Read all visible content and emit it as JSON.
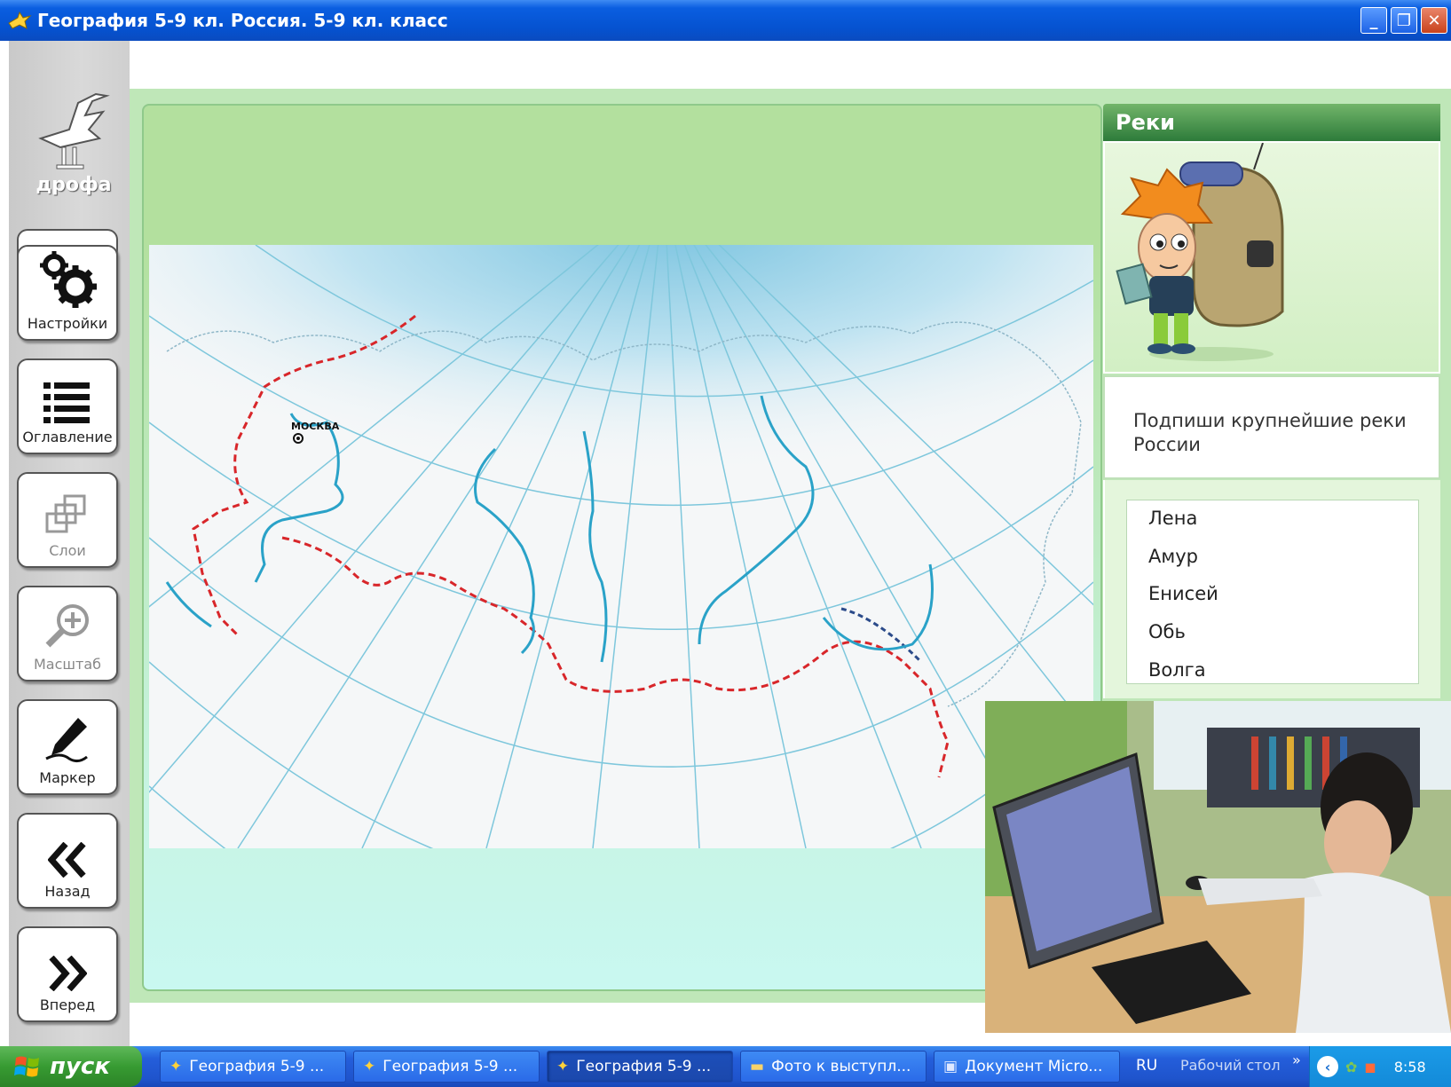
{
  "window": {
    "title": "География 5-9 кл. Россия. 5-9 кл. класс",
    "minimize_label": "_",
    "restore_label": "❐",
    "close_label": "✕"
  },
  "sidebar": {
    "logo_text": "дрофа",
    "buttons": [
      {
        "label": "Настройки",
        "icon": "gear-icon",
        "enabled": true
      },
      {
        "label": "Оглавление",
        "icon": "list-icon",
        "enabled": true
      },
      {
        "label": "Слои",
        "icon": "layers-icon",
        "enabled": false
      },
      {
        "label": "Масштаб",
        "icon": "zoom-icon",
        "enabled": false
      },
      {
        "label": "Маркер",
        "icon": "marker-icon",
        "enabled": true
      },
      {
        "label": "Назад",
        "icon": "double-chevron-left-icon",
        "enabled": true
      },
      {
        "label": "Вперед",
        "icon": "double-chevron-right-icon",
        "enabled": true
      }
    ]
  },
  "map": {
    "city_label": "МОСКВА"
  },
  "task": {
    "header": "Реки",
    "instruction": "Подпиши крупнейшие реки России",
    "answers": [
      "Лена",
      "Амур",
      "Енисей",
      "Обь",
      "Волга"
    ]
  },
  "taskbar": {
    "start_label": "пуск",
    "items": [
      {
        "label": "География 5-9 ...",
        "active": false
      },
      {
        "label": "География 5-9 ...",
        "active": false
      },
      {
        "label": "География 5-9 ...",
        "active": true
      },
      {
        "label": "Фото к выступл...",
        "active": false
      },
      {
        "label": "Документ Micro...",
        "active": false
      }
    ],
    "language": "RU",
    "desktop_label": "Рабочий стол",
    "clock": "8:58"
  },
  "colors": {
    "accent_green": "#2d7b3a",
    "map_panel": "#b3e09e",
    "river": "#2aa2c8",
    "border_line": "#d8262a",
    "title_blue": "#0552d0"
  }
}
